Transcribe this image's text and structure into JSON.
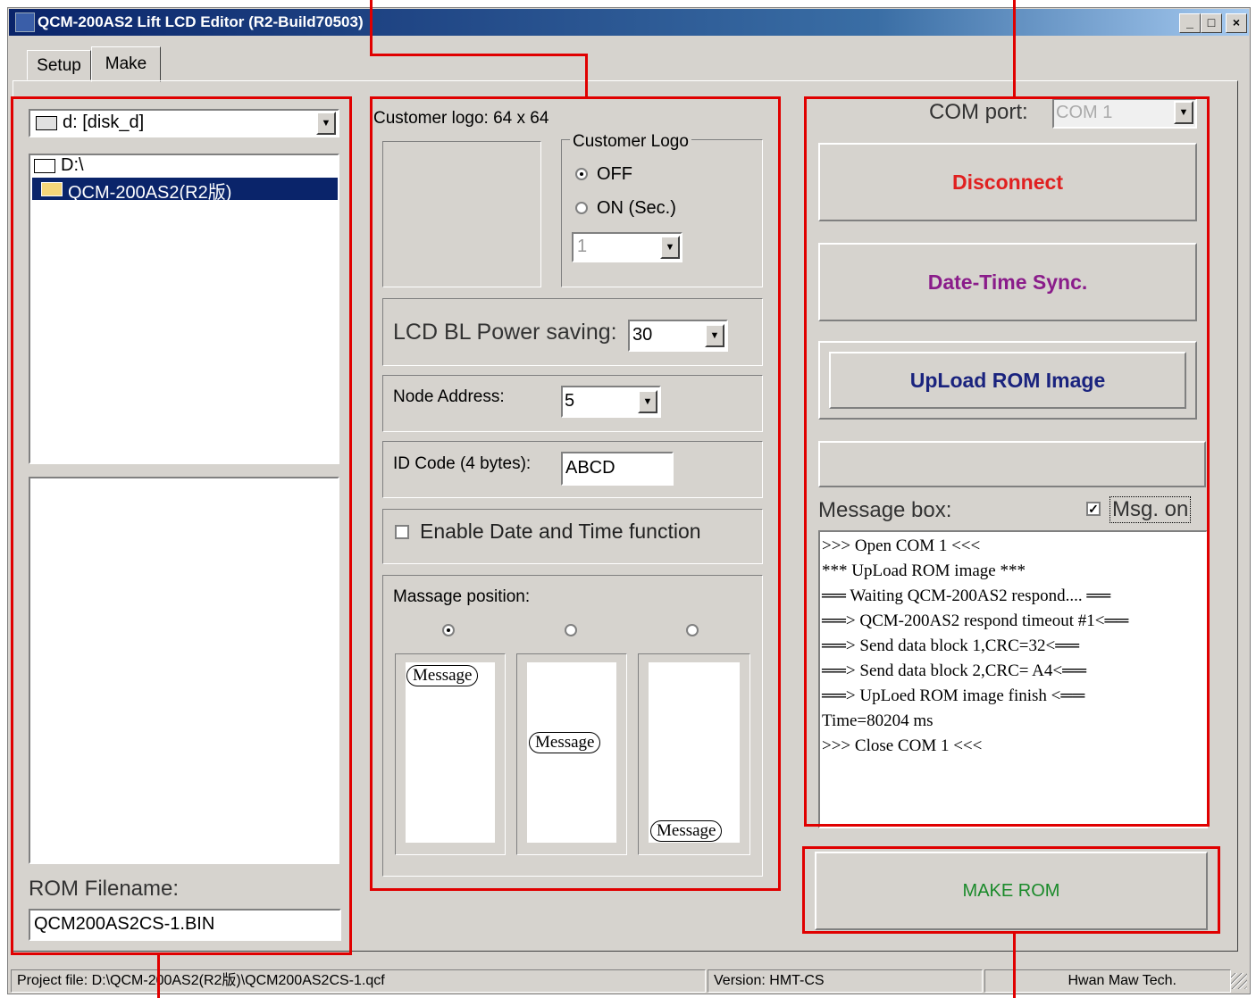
{
  "window": {
    "title": "QCM-200AS2 Lift LCD Editor (R2-Build70503)",
    "minimize": "_",
    "maximize": "□",
    "close": "×"
  },
  "tabs": [
    "Setup",
    "Make"
  ],
  "left": {
    "drive": "d: [disk_d]",
    "folders": [
      "D:\\",
      "QCM-200AS2(R2版)"
    ],
    "rom_label": "ROM Filename:",
    "rom_value": "QCM200AS2CS-1.BIN"
  },
  "middle": {
    "logo_label": "Customer logo:  64 x 64",
    "logo_group": "Customer Logo",
    "logo_off": "OFF",
    "logo_on": "ON (Sec.)",
    "logo_sec_value": "1",
    "bl_label": "LCD BL Power saving:",
    "bl_value": "30",
    "node_label": "Node Address:",
    "node_value": "5",
    "id_label": "ID Code (4 bytes):",
    "id_value": "ABCD",
    "datetime_label": "Enable Date and Time function",
    "position_label": "Massage position:",
    "message_pill": "Message"
  },
  "right": {
    "com_label": "COM port:",
    "com_value": "COM 1",
    "disconnect": "Disconnect",
    "sync": "Date-Time Sync.",
    "upload": "UpLoad ROM Image",
    "msgbox_label": "Message box:",
    "msg_on": "Msg. on",
    "log": [
      ">>> Open COM 1 <<<",
      "*** UpLoad ROM image ***",
      "══ Waiting QCM-200AS2 respond.... ══",
      "══> QCM-200AS2 respond timeout #1<══",
      "══> Send data block 1,CRC=32<══",
      "══> Send data block 2,CRC= A4<══",
      "══> UpLoed ROM image finish <══",
      "Time=80204 ms",
      ">>> Close COM 1 <<<"
    ],
    "make_rom": "MAKE ROM"
  },
  "status": {
    "project": "Project file: D:\\QCM-200AS2(R2版)\\QCM200AS2CS-1.qcf",
    "version": "Version: HMT-CS",
    "company": "Hwan Maw Tech."
  },
  "colors": {
    "disconnect": "#e02020",
    "sync": "#8a1c8a",
    "upload": "#1a237e",
    "make_rom": "#1a8a2a",
    "annotation": "#e00000"
  }
}
